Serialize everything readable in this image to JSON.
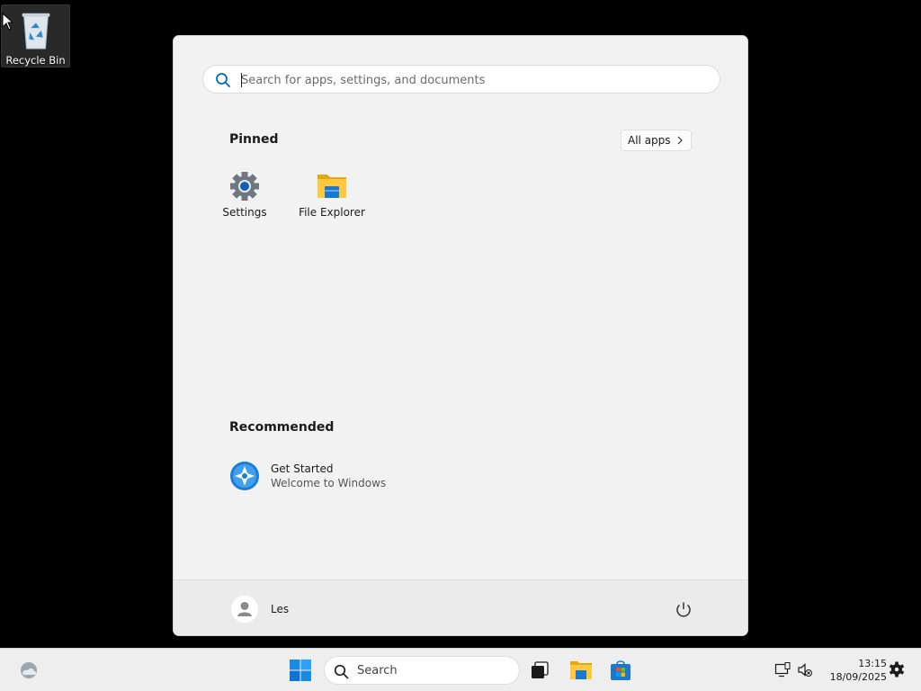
{
  "desktop": {
    "recycle_bin_label": "Recycle Bin"
  },
  "start_menu": {
    "search_placeholder": "Search for apps, settings, and documents",
    "pinned_title": "Pinned",
    "all_apps_label": "All apps",
    "pinned_apps": [
      {
        "label": "Settings",
        "icon": "gear-icon"
      },
      {
        "label": "File Explorer",
        "icon": "folder-icon"
      }
    ],
    "recommended_title": "Recommended",
    "recommended": [
      {
        "title": "Get Started",
        "subtitle": "Welcome to Windows",
        "icon": "get-started-icon"
      }
    ],
    "user_name": "Les"
  },
  "taskbar": {
    "search_label": "Search",
    "time": "13:15",
    "date": "18/09/2025"
  },
  "colors": {
    "accent": "#0078d4",
    "start_bg": "#f2f2f2",
    "taskbar_bg": "#eeeeee"
  }
}
